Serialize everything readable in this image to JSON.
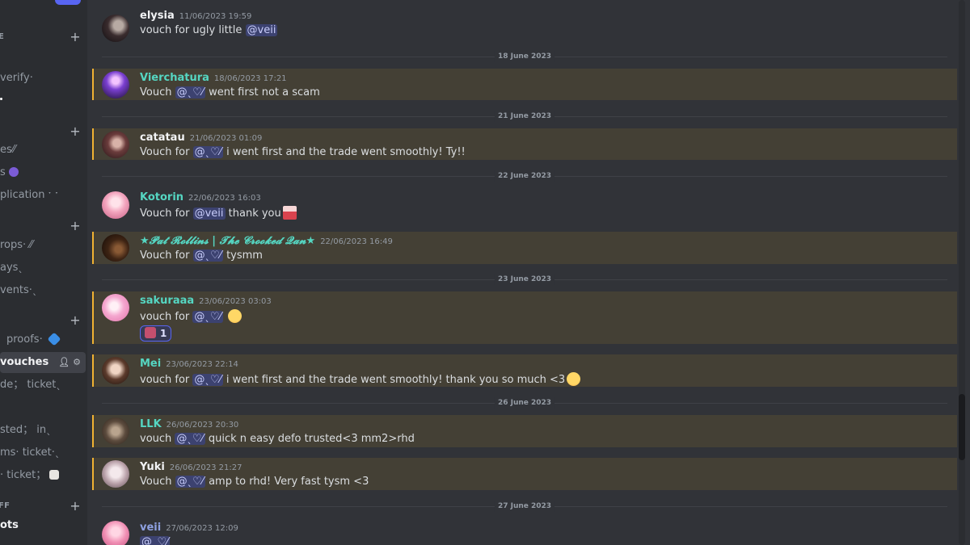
{
  "sidebar": {
    "categories": [
      {
        "label": "E"
      },
      {
        "label": "FF"
      }
    ],
    "channels": [
      {
        "label": "verify‧"
      },
      {
        "label": "es⁄⁄"
      },
      {
        "label": "s"
      },
      {
        "label": "plication ˑ ˑ"
      },
      {
        "label": "rops‧  ⁄⁄"
      },
      {
        "label": "aysˎ"
      },
      {
        "label": "vents‧ˎ"
      },
      {
        "label": "proofs‧"
      },
      {
        "label": "vouches"
      },
      {
        "label": "de； ticketˎ"
      },
      {
        "label": "sted； inˎ"
      },
      {
        "label": "ms‧ ticket‧ˎ"
      },
      {
        "label": "‧ ticket；"
      },
      {
        "label": "ots"
      }
    ]
  },
  "chat": {
    "messages": [
      {
        "author": "elysia",
        "author_color": "#f2f3f5",
        "timestamp": "11/06/2023 19:59",
        "pre": "vouch for ugly little ",
        "mention": "@veii",
        "post": ""
      },
      {
        "author": "Vierchatura",
        "author_color": "#55d6c2",
        "timestamp": "18/06/2023 17:21",
        "pre": "Vouch ",
        "mention": "@ˎ♡⁄",
        "post": "  went first not a scam"
      },
      {
        "author": "catatau",
        "author_color": "#f2f3f5",
        "timestamp": "21/06/2023 01:09",
        "pre": "Vouch for ",
        "mention": "@ˎ♡⁄",
        "post": " i went first and the trade went smoothly! Ty!!"
      },
      {
        "author": "Kotorin",
        "author_color": "#55d6c2",
        "timestamp": "22/06/2023 16:03",
        "pre": "Vouch for ",
        "mention": "@veii",
        "post": " thank you"
      },
      {
        "author": "★𝓟𝓪𝓽 𝓡𝓸𝓵𝓵𝓲𝓷𝓼 | 𝓣𝓱𝓮 𝓒𝓻𝓸𝓸𝓴𝓮𝓭 𝓠𝓪𝓷★",
        "author_color": "#55d6c2",
        "timestamp": "22/06/2023 16:49",
        "pre": "Vouch for ",
        "mention": "@ˎ♡⁄",
        "post": " tysmm"
      },
      {
        "author": "sakuraaa",
        "author_color": "#55d6c2",
        "timestamp": "23/06/2023 03:03",
        "pre": "vouch for ",
        "mention": "@ˎ♡⁄",
        "post": " ",
        "reaction_count": "1"
      },
      {
        "author": "Mei",
        "author_color": "#55d6c2",
        "timestamp": "23/06/2023 22:14",
        "pre": "vouch for ",
        "mention": "@ˎ♡⁄",
        "post": "  i went first and the trade went smoothly! thank you so much  <3"
      },
      {
        "author": "LLK",
        "author_color": "#55d6c2",
        "timestamp": "26/06/2023 20:30",
        "pre": "vouch ",
        "mention": "@ˎ♡⁄",
        "post": " quick n easy defo trusted<3  mm2>rhd"
      },
      {
        "author": "Yuki",
        "author_color": "#f2f3f5",
        "timestamp": "26/06/2023 21:27",
        "pre": "Vouch ",
        "mention": "@ˎ♡⁄",
        "post": " amp to rhd! Very fast tysm <3"
      },
      {
        "author": "veii",
        "author_color": "#8ea1e1",
        "timestamp": "27/06/2023 12:09",
        "pre": "",
        "mention": "@ˎ♡⁄",
        "post": ""
      }
    ],
    "dividers": [
      "18 June 2023",
      "21 June 2023",
      "22 June 2023",
      "23 June 2023",
      "26 June 2023",
      "27 June 2023"
    ]
  },
  "colors": {
    "background": "#313338",
    "sidebar": "#2b2d31",
    "mention_highlight": "#444035",
    "mention_bar": "#f0b232",
    "mention_pill": "#3c4270",
    "teal_role": "#55d6c2"
  }
}
